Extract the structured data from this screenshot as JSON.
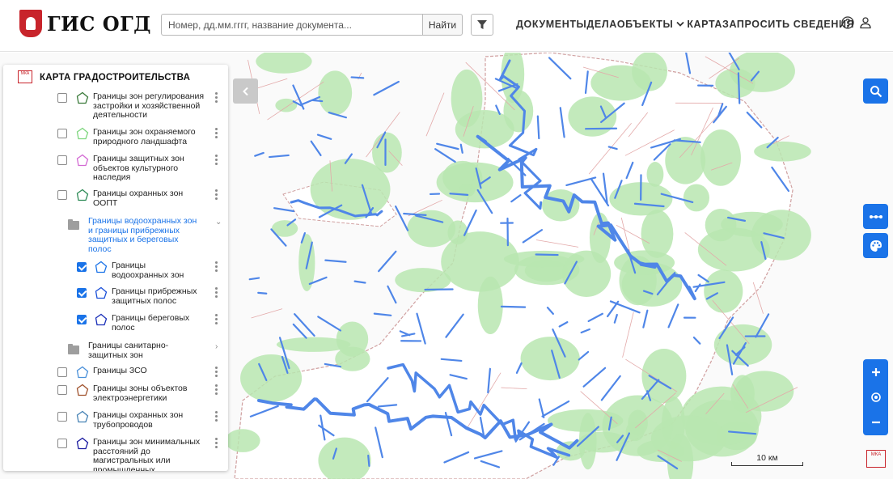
{
  "header": {
    "logo_text": "ГИС ОГД",
    "search_placeholder": "Номер, дд.мм.гггг, название документа...",
    "search_button": "Найти",
    "nav": [
      "ДОКУМЕНТЫ",
      "ДЕЛА",
      "ОБЪЕКТЫ",
      "КАРТА",
      "ЗАПРОСИТЬ СВЕДЕНИЯ"
    ],
    "icons": [
      "help-icon",
      "user-icon"
    ]
  },
  "panel": {
    "title": "КАРТА ГРАДОСТРОИТЕЛЬСТВА",
    "mka_logo": "МКА",
    "cut_text": "наследия",
    "layers": [
      {
        "label_lines": [
          "Границы зон регулирования",
          "застройки и хозяйственной",
          "деятельности"
        ],
        "checked": false,
        "color": "#3a7a3a"
      },
      {
        "label_lines": [
          "Границы зон охраняемого",
          "природного ландшафта"
        ],
        "checked": false,
        "color": "#7ed67e"
      },
      {
        "label_lines": [
          "Границы защитных зон",
          "объектов культурного",
          "наследия"
        ],
        "checked": false,
        "color": "#d36ad3"
      },
      {
        "label_lines": [
          "Границы охранных зон",
          "ООПТ"
        ],
        "checked": false,
        "color": "#2e8b57"
      },
      {
        "label_lines": [
          "Границы водоохранных зон",
          "и границы прибрежных",
          "защитных и береговых",
          "полос"
        ],
        "folder": true,
        "expanded": true,
        "active": true
      },
      {
        "label_lines": [
          "Границы",
          "водоохранных зон"
        ],
        "checked": true,
        "color": "#1a73e8"
      },
      {
        "label_lines": [
          "Границы прибрежных",
          "защитных полос"
        ],
        "checked": true,
        "color": "#1a4fd8"
      },
      {
        "label_lines": [
          "Границы береговых",
          "полос"
        ],
        "checked": true,
        "color": "#1a2fb8"
      },
      {
        "label_lines": [
          "Границы санитарно-",
          "защитных зон"
        ],
        "folder": true,
        "expanded": false
      },
      {
        "label_lines": [
          "Границы ЗСО"
        ],
        "checked": false,
        "color": "#4a90d9"
      },
      {
        "label_lines": [
          "Границы зоны объектов",
          "электроэнергетики"
        ],
        "checked": false,
        "color": "#a0522d"
      },
      {
        "label_lines": [
          "Границы охранных зон",
          "трубопроводов"
        ],
        "checked": false,
        "color": "#4682b4"
      },
      {
        "label_lines": [
          "Границы зон минимальных",
          "расстояний до",
          "магистральных или",
          "промышленных"
        ],
        "checked": false,
        "color": "#1a1aa0"
      }
    ]
  },
  "map": {
    "scale_label": "10 км",
    "mka_logo": "МКА",
    "controls": [
      "search-icon",
      "more-icon",
      "palette-icon",
      "zoom-in",
      "locate-icon",
      "zoom-out"
    ],
    "colors": {
      "green": "#b8e6b0",
      "water": "#4f86e8",
      "admin": "#d0a0a0"
    }
  }
}
